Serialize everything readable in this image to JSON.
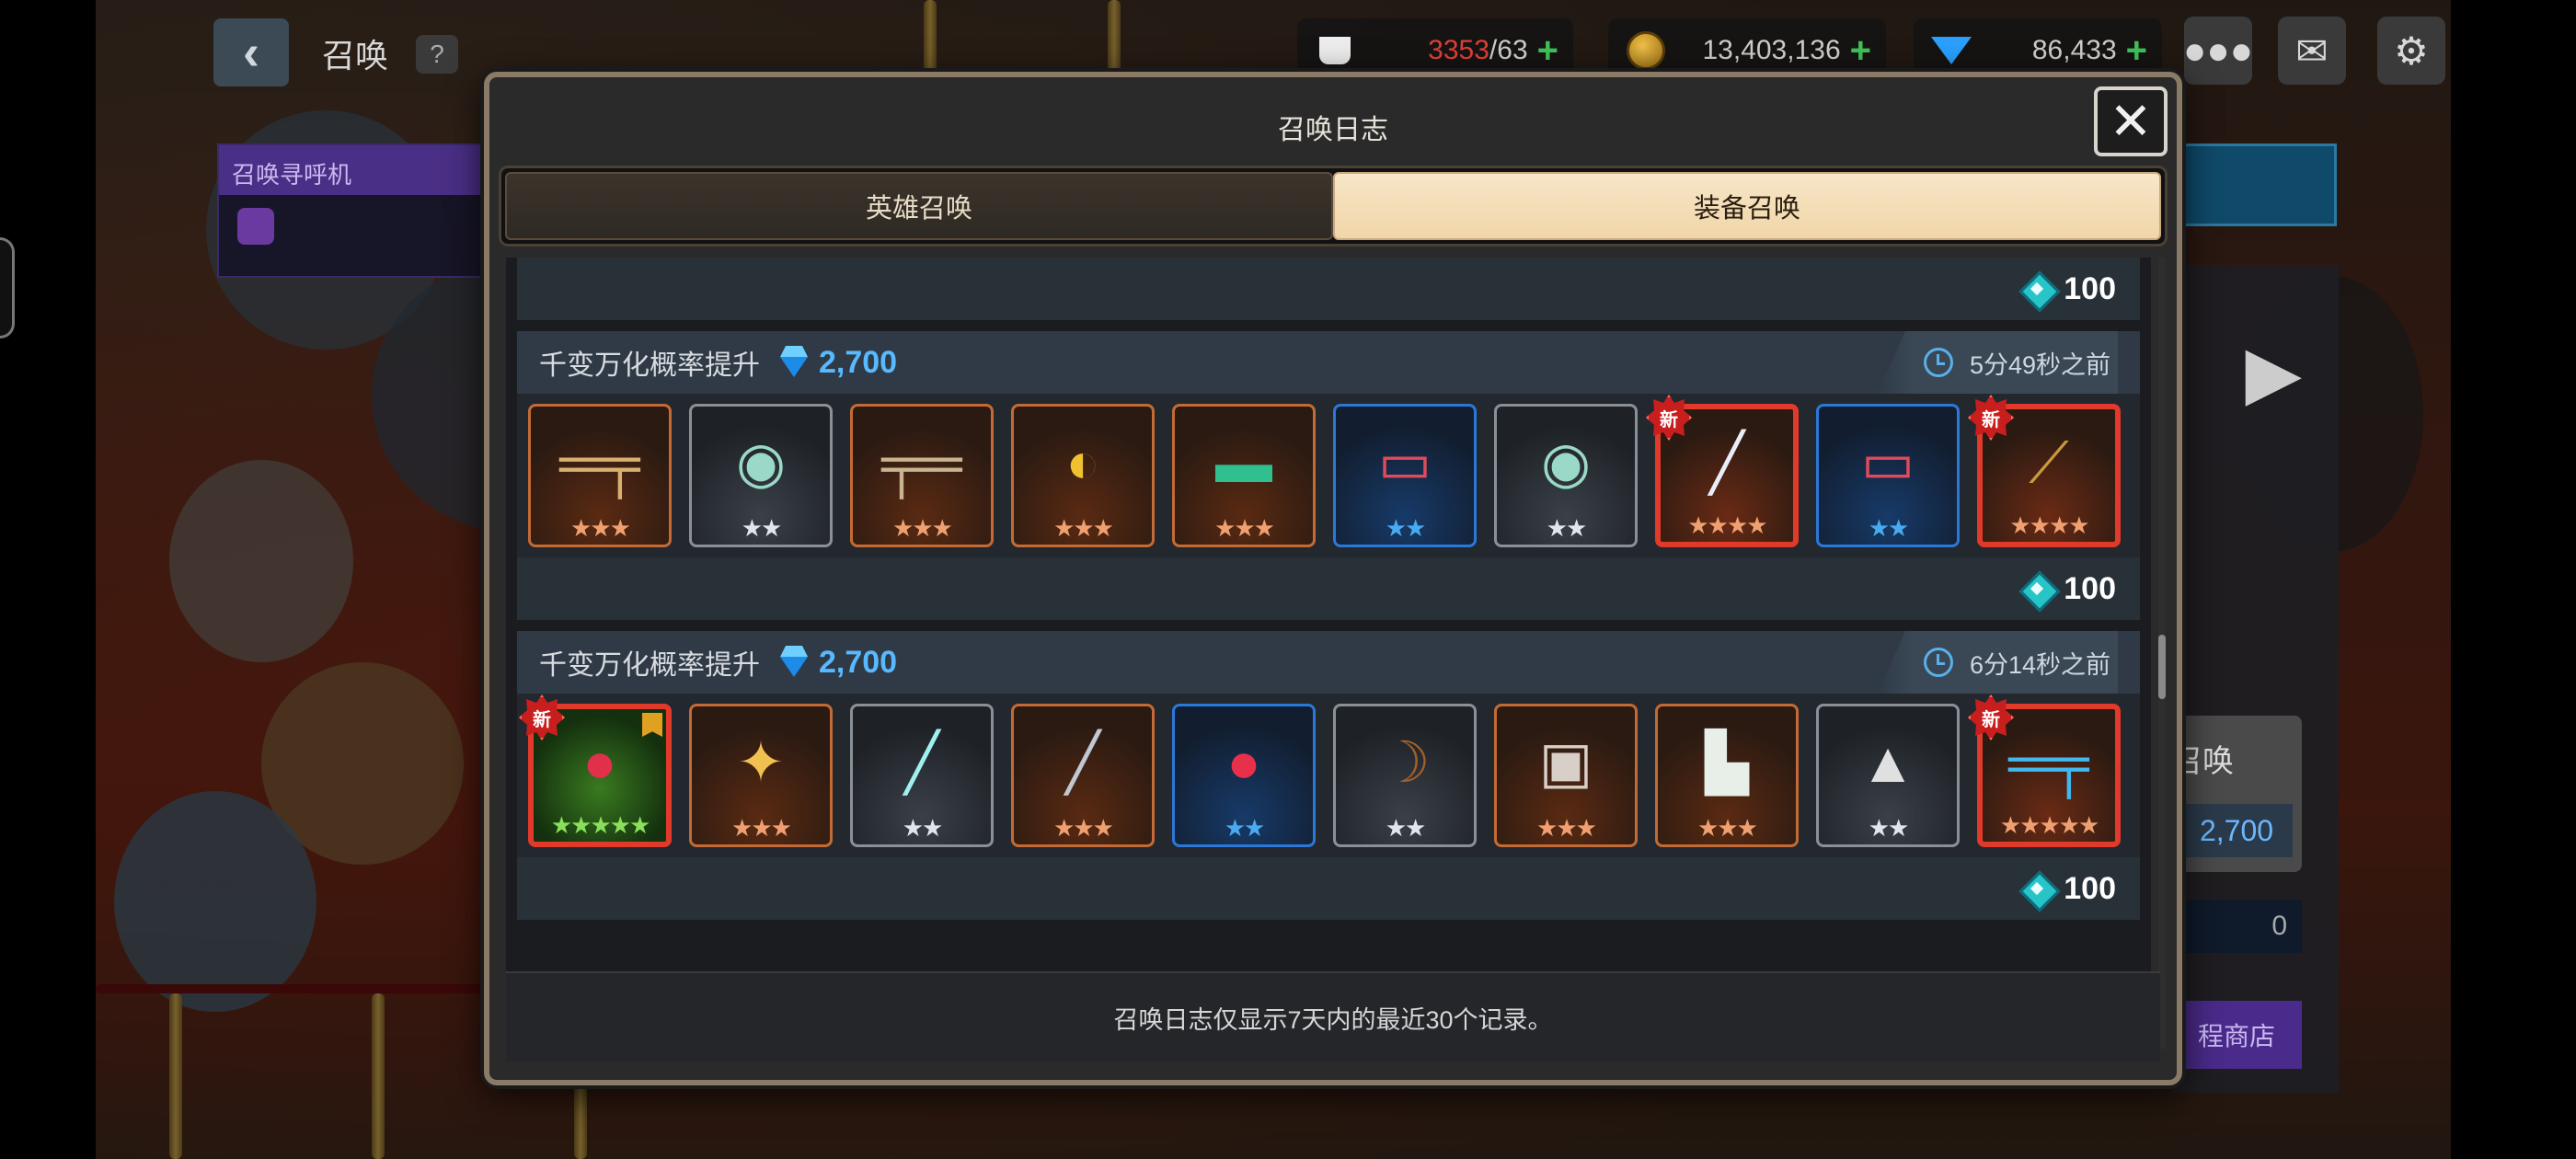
{
  "hud": {
    "title": "召唤",
    "help": "?",
    "stamina": {
      "current": "3353",
      "max": "/63"
    },
    "gold": "13,403,136",
    "gems": "86,433",
    "plus": "+"
  },
  "side_panel": {
    "pager_label": "召唤寻呼机"
  },
  "right_panel": {
    "summon_label": "召唤",
    "price": "2,700",
    "count": "0",
    "shop_label": "程商店"
  },
  "modal": {
    "title": "召唤日志",
    "close": "✕",
    "tabs": [
      {
        "label": "英雄召唤",
        "active": false
      },
      {
        "label": "装备召唤",
        "active": true
      }
    ],
    "top_total": "100",
    "entries": [
      {
        "title": "千变万化概率提升",
        "cost": "2,700",
        "time": "5分49秒之前",
        "total": "100",
        "items": [
          {
            "icon": "rifle",
            "art": "═╤",
            "rarity": "r3",
            "stars": "★★★",
            "star_color": "s-o",
            "is_new": false
          },
          {
            "icon": "ring",
            "art": "◉",
            "rarity": "r2",
            "stars": "★★",
            "star_color": "s-w",
            "is_new": false
          },
          {
            "icon": "assault-rifle",
            "art": "╤═",
            "rarity": "r3",
            "stars": "★★★",
            "star_color": "s-o",
            "is_new": false
          },
          {
            "icon": "gold-shield",
            "art": "◐",
            "rarity": "r3",
            "stars": "★★★",
            "star_color": "s-o",
            "is_new": false
          },
          {
            "icon": "green-blaster",
            "art": "▬",
            "rarity": "r3",
            "stars": "★★★",
            "star_color": "s-o",
            "is_new": false
          },
          {
            "icon": "red-launcher",
            "art": "▭",
            "rarity": "rb",
            "stars": "★★",
            "star_color": "s-b",
            "is_new": false
          },
          {
            "icon": "ring",
            "art": "◉",
            "rarity": "r2",
            "stars": "★★",
            "star_color": "s-w",
            "is_new": false
          },
          {
            "icon": "greatsword",
            "art": "╱",
            "rarity": "r4",
            "stars": "★★★★",
            "star_color": "s-o",
            "is_new": true
          },
          {
            "icon": "red-launcher",
            "art": "▭",
            "rarity": "rb",
            "stars": "★★",
            "star_color": "s-b",
            "is_new": false
          },
          {
            "icon": "golden-spear",
            "art": "⟋",
            "rarity": "r4",
            "stars": "★★★★",
            "star_color": "s-o",
            "is_new": true
          }
        ]
      },
      {
        "title": "千变万化概率提升",
        "cost": "2,700",
        "time": "6分14秒之前",
        "total": "100",
        "items": [
          {
            "icon": "red-orb",
            "art": "●",
            "rarity": "g4",
            "stars": "★★★★★",
            "star_color": "s-g",
            "is_new": true,
            "flag": true
          },
          {
            "icon": "holy-sword",
            "art": "✦",
            "rarity": "r3",
            "stars": "★★★",
            "star_color": "s-o",
            "is_new": false
          },
          {
            "icon": "staff",
            "art": "╱",
            "rarity": "r2",
            "stars": "★★",
            "star_color": "s-w",
            "is_new": false
          },
          {
            "icon": "dark-sword",
            "art": "╱",
            "rarity": "r3",
            "stars": "★★★",
            "star_color": "s-o",
            "is_new": false
          },
          {
            "icon": "red-potion",
            "art": "●",
            "rarity": "rb",
            "stars": "★★",
            "star_color": "s-b",
            "is_new": false
          },
          {
            "icon": "bow",
            "art": "☽",
            "rarity": "r2",
            "stars": "★★",
            "star_color": "s-w",
            "is_new": false
          },
          {
            "icon": "armor-box",
            "art": "▣",
            "rarity": "r3",
            "stars": "★★★",
            "star_color": "s-o",
            "is_new": false
          },
          {
            "icon": "boot",
            "art": "▙",
            "rarity": "r3",
            "stars": "★★★",
            "star_color": "s-o",
            "is_new": false
          },
          {
            "icon": "helmet",
            "art": "▲",
            "rarity": "r2",
            "stars": "★★",
            "star_color": "s-w",
            "is_new": false
          },
          {
            "icon": "blue-rifle",
            "art": "═╤",
            "rarity": "r4",
            "stars": "★★★★★",
            "star_color": "s-o",
            "is_new": true
          }
        ]
      }
    ],
    "new_badge": "新",
    "footer": "召唤日志仅显示7天内的最近30个记录。"
  },
  "colors": {
    "accent_blue": "#58b9ff",
    "tab_active": "#f0d6a8",
    "new_badge": "#c81e1e"
  }
}
